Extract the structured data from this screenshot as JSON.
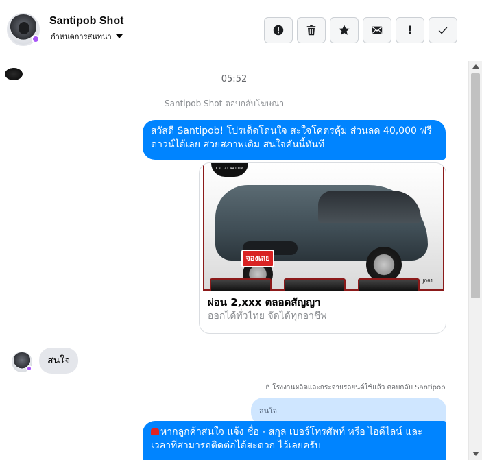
{
  "header": {
    "contact_name": "Santipob Shot",
    "assign_label": "กำหนดการสนทนา",
    "actions": [
      {
        "name": "alert-circle",
        "label": ""
      },
      {
        "name": "trash",
        "label": ""
      },
      {
        "name": "star",
        "label": ""
      },
      {
        "name": "mail",
        "label": ""
      },
      {
        "name": "exclamation",
        "label": "!"
      },
      {
        "name": "check",
        "label": ""
      }
    ]
  },
  "thread": {
    "timestamp": "05:52",
    "reply_note": "Santipob Shot ตอบกลับโฆษณา",
    "messages": {
      "page_greeting": "สวัสดี Santipob! โปรเด็ดโดนใจ สะใจโคตรคุ้ม ส่วนลด 40,000 ฟรีดาวน์ได้เลย สวยสภาพเดิม สนใจคันนี้ทันที",
      "customer_reply": "สนใจ",
      "quoted_text": "สนใจ",
      "page_followup": "หากลูกค้าสนใจ แจ้ง ชื่อ - สกุล เบอร์โทรศัพท์ หรือ ไอดีไลน์ และเวลาที่สามารถติดต่อได้สะดวก ไว้เลยครับ"
    },
    "ad_card": {
      "title": "ผ่อน 2,xxx ตลอดสัญญา",
      "subtitle": "ออกได้ทั่วไทย จัดได้ทุกอาชีพ",
      "image_tag": "จองเลย",
      "image_brand": "CKC 2 CAR.COM",
      "image_code": "J061"
    },
    "reply_context": "โรงงานผลิตและกระจายรถยนต์ใช้แล้ว ตอบกลับ Santipob"
  },
  "colors": {
    "outgoing_bubble": "#0084ff",
    "incoming_bubble": "#e4e6eb",
    "quoted_bubble": "#cfe6ff",
    "status_badge": "#a855f7"
  }
}
